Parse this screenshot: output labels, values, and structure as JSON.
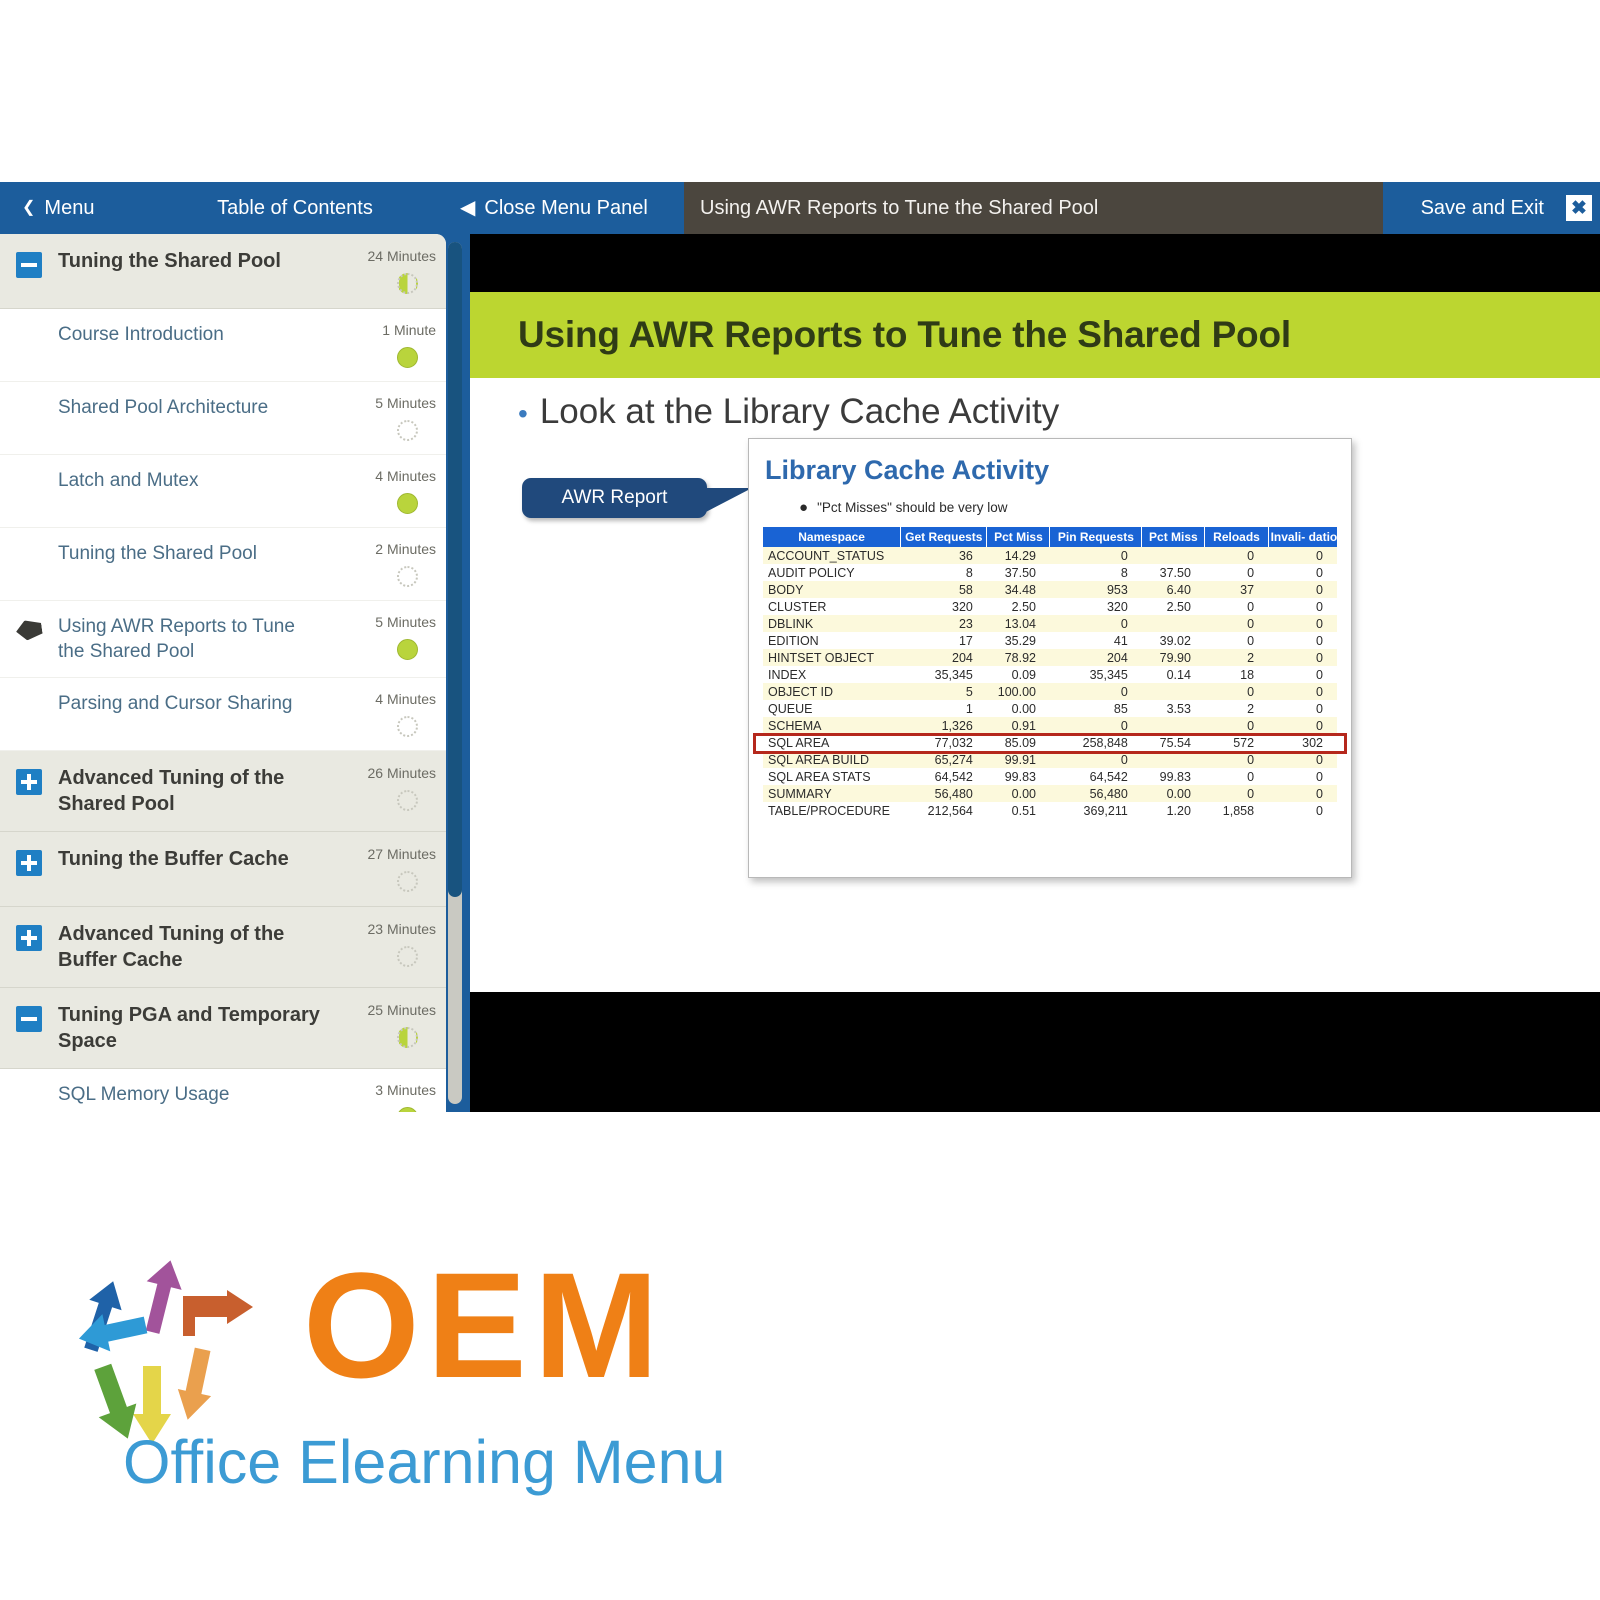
{
  "topbar": {
    "menu_label": "Menu",
    "menu_caret": "chevron-left",
    "toc_label": "Table of Contents",
    "close_panel_label": "Close Menu Panel",
    "close_panel_caret": "◀",
    "slide_title": "Using AWR Reports to Tune the Shared Pool",
    "save_exit_label": "Save and Exit",
    "close_glyph": "✖"
  },
  "toc": {
    "items": [
      {
        "label": "Tuning the Shared Pool",
        "duration": "24 Minutes",
        "type": "group",
        "expander": "minus",
        "status": "partial",
        "current": false
      },
      {
        "label": "Course Introduction",
        "duration": "1 Minute",
        "type": "leaf",
        "status": "complete",
        "current": false
      },
      {
        "label": "Shared Pool Architecture",
        "duration": "5 Minutes",
        "type": "leaf",
        "status": "notstarted",
        "current": false
      },
      {
        "label": "Latch and Mutex",
        "duration": "4 Minutes",
        "type": "leaf",
        "status": "complete",
        "current": false
      },
      {
        "label": "Tuning the Shared Pool",
        "duration": "2 Minutes",
        "type": "leaf",
        "status": "notstarted",
        "current": false
      },
      {
        "label": "Using AWR Reports to Tune the Shared Pool",
        "duration": "5 Minutes",
        "type": "leaf",
        "status": "complete",
        "current": true
      },
      {
        "label": "Parsing and Cursor Sharing",
        "duration": "4 Minutes",
        "type": "leaf",
        "status": "notstarted",
        "current": false
      },
      {
        "label": "Advanced Tuning of the Shared Pool",
        "duration": "26 Minutes",
        "type": "group",
        "expander": "plus",
        "status": "notstarted",
        "current": false
      },
      {
        "label": "Tuning the Buffer Cache",
        "duration": "27 Minutes",
        "type": "group",
        "expander": "plus",
        "status": "notstarted",
        "current": false
      },
      {
        "label": "Advanced Tuning of the Buffer Cache",
        "duration": "23 Minutes",
        "type": "group",
        "expander": "plus",
        "status": "notstarted",
        "current": false
      },
      {
        "label": "Tuning PGA and Temporary Space",
        "duration": "25 Minutes",
        "type": "group",
        "expander": "minus",
        "status": "partial",
        "current": false
      },
      {
        "label": "SQL Memory Usage",
        "duration": "3 Minutes",
        "type": "leaf",
        "status": "complete",
        "current": false
      }
    ]
  },
  "slide": {
    "title": "Using AWR Reports to Tune the Shared Pool",
    "bullet": "Look at the Library Cache Activity",
    "callout_label": "AWR Report",
    "card": {
      "heading": "Library Cache Activity",
      "note": "\"Pct Misses\" should be very low",
      "headers": [
        "Namespace",
        "Get Requests",
        "Pct Miss",
        "Pin Requests",
        "Pct Miss",
        "Reloads",
        "Invali- dations"
      ],
      "rows": [
        [
          "ACCOUNT_STATUS",
          "36",
          "14.29",
          "0",
          "",
          "0",
          "0"
        ],
        [
          "AUDIT POLICY",
          "8",
          "37.50",
          "8",
          "37.50",
          "0",
          "0"
        ],
        [
          "BODY",
          "58",
          "34.48",
          "953",
          "6.40",
          "37",
          "0"
        ],
        [
          "CLUSTER",
          "320",
          "2.50",
          "320",
          "2.50",
          "0",
          "0"
        ],
        [
          "DBLINK",
          "23",
          "13.04",
          "0",
          "",
          "0",
          "0"
        ],
        [
          "EDITION",
          "17",
          "35.29",
          "41",
          "39.02",
          "0",
          "0"
        ],
        [
          "HINTSET OBJECT",
          "204",
          "78.92",
          "204",
          "79.90",
          "2",
          "0"
        ],
        [
          "INDEX",
          "35,345",
          "0.09",
          "35,345",
          "0.14",
          "18",
          "0"
        ],
        [
          "OBJECT ID",
          "5",
          "100.00",
          "0",
          "",
          "0",
          "0"
        ],
        [
          "QUEUE",
          "1",
          "0.00",
          "85",
          "3.53",
          "2",
          "0"
        ],
        [
          "SCHEMA",
          "1,326",
          "0.91",
          "0",
          "",
          "0",
          "0"
        ],
        [
          "SQL AREA",
          "77,032",
          "85.09",
          "258,848",
          "75.54",
          "572",
          "302"
        ],
        [
          "SQL AREA BUILD",
          "65,274",
          "99.91",
          "0",
          "",
          "0",
          "0"
        ],
        [
          "SQL AREA STATS",
          "64,542",
          "99.83",
          "64,542",
          "99.83",
          "0",
          "0"
        ],
        [
          "SUMMARY",
          "56,480",
          "0.00",
          "56,480",
          "0.00",
          "0",
          "0"
        ],
        [
          "TABLE/PROCEDURE",
          "212,564",
          "0.51",
          "369,211",
          "1.20",
          "1,858",
          "0"
        ]
      ],
      "highlight_row_index": 11,
      "highlight_color": "#b5281c"
    }
  },
  "logo": {
    "wordmark": "OEM",
    "tagline": "Office Elearning Menu",
    "wordmark_color": "#ef8016",
    "tagline_color": "#3c9bd4"
  },
  "colors": {
    "topbar_blue": "#1c5d9c",
    "title_strip_gray": "#4b463e",
    "slide_header_green": "#bcd630",
    "callout_navy": "#20497c",
    "table_header_blue": "#1963d4",
    "status_green": "#b9d43c"
  }
}
